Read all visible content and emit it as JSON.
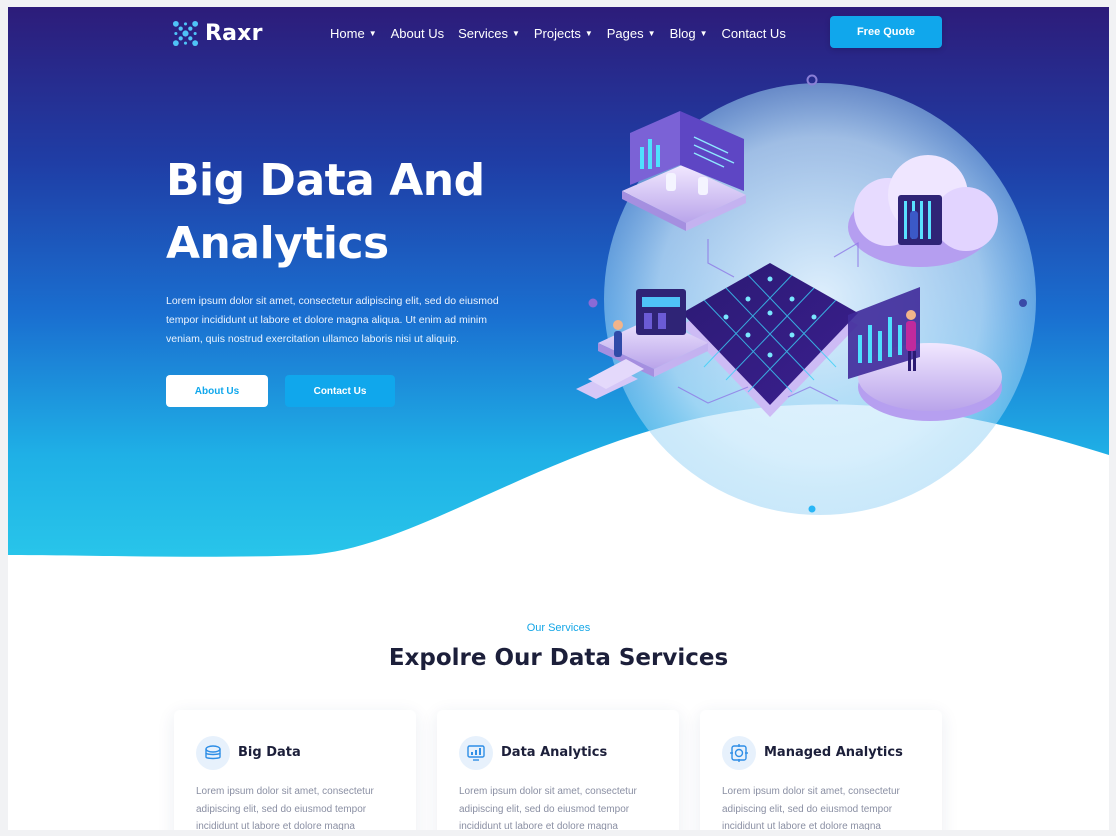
{
  "brand": {
    "name": "Raxr"
  },
  "nav": {
    "items": [
      {
        "label": "Home",
        "dropdown": true
      },
      {
        "label": "About Us",
        "dropdown": false
      },
      {
        "label": "Services",
        "dropdown": true
      },
      {
        "label": "Projects",
        "dropdown": true
      },
      {
        "label": "Pages",
        "dropdown": true
      },
      {
        "label": "Blog",
        "dropdown": true
      },
      {
        "label": "Contact Us",
        "dropdown": false
      }
    ],
    "cta_label": "Free Quote"
  },
  "hero": {
    "title_line1": "Big Data And",
    "title_line2": "Analytics",
    "text": "Lorem ipsum dolor sit amet, consectetur adipiscing elit, sed do eiusmod tempor incididunt ut labore et dolore magna aliqua. Ut enim ad minim veniam, quis nostrud exercitation ullamco laboris nisi ut aliquip.",
    "primary_button": "About Us",
    "secondary_button": "Contact Us"
  },
  "services": {
    "subtitle": "Our Services",
    "title": "Expolre Our Data Services",
    "cards": [
      {
        "title": "Big Data",
        "icon": "big-data-icon",
        "text": "Lorem ipsum dolor sit amet, consectetur adipiscing elit, sed do eiusmod tempor incididunt ut labore et dolore magna"
      },
      {
        "title": "Data Analytics",
        "icon": "data-analytics-icon",
        "text": "Lorem ipsum dolor sit amet, consectetur adipiscing elit, sed do eiusmod tempor incididunt ut labore et dolore magna"
      },
      {
        "title": "Managed Analytics",
        "icon": "managed-analytics-icon",
        "text": "Lorem ipsum dolor sit amet, consectetur adipiscing elit, sed do eiusmod tempor incididunt ut labore et dolore magna"
      }
    ]
  },
  "colors": {
    "accent": "#10a7ec",
    "hero_top": "#2d1c7a",
    "hero_bottom": "#29c7ea",
    "heading": "#1c1f3a"
  }
}
